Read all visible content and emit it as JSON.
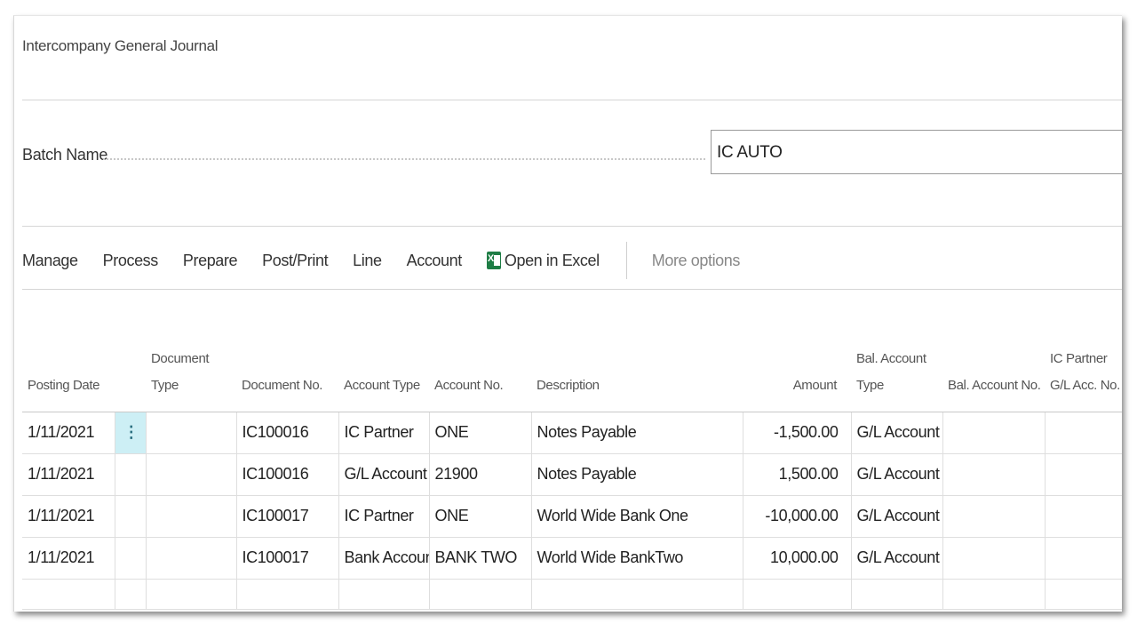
{
  "page": {
    "title": "Intercompany General Journal"
  },
  "batch": {
    "label": "Batch Name",
    "value": "IC AUTO"
  },
  "menu": {
    "items": [
      "Manage",
      "Process",
      "Prepare",
      "Post/Print",
      "Line",
      "Account"
    ],
    "open_in_excel": "Open in Excel",
    "more_options": "More options"
  },
  "grid": {
    "headers": {
      "posting_date": "Posting Date",
      "document_type": "Document Type",
      "document_no": "Document No.",
      "account_type": "Account Type",
      "account_no": "Account No.",
      "description": "Description",
      "amount": "Amount",
      "bal_account_type": "Bal. Account Type",
      "bal_account_no": "Bal. Account No.",
      "ic_partner_gl": "IC Partner G/L Acc. No."
    },
    "row_menu_icon": "⋮",
    "rows": [
      {
        "posting_date": "1/11/2021",
        "document_type": "",
        "document_no": "IC100016",
        "account_type": "IC Partner",
        "account_no": "ONE",
        "description": "Notes Payable",
        "amount": "-1,500.00",
        "bal_account_type": "G/L Account",
        "bal_account_no": "",
        "ic_partner_gl": ""
      },
      {
        "posting_date": "1/11/2021",
        "document_type": "",
        "document_no": "IC100016",
        "account_type": "G/L Account",
        "account_no": "21900",
        "description": "Notes Payable",
        "amount": "1,500.00",
        "bal_account_type": "G/L Account",
        "bal_account_no": "",
        "ic_partner_gl": ""
      },
      {
        "posting_date": "1/11/2021",
        "document_type": "",
        "document_no": "IC100017",
        "account_type": "IC Partner",
        "account_no": "ONE",
        "description": "World Wide Bank One",
        "amount": "-10,000.00",
        "bal_account_type": "G/L Account",
        "bal_account_no": "",
        "ic_partner_gl": ""
      },
      {
        "posting_date": "1/11/2021",
        "document_type": "",
        "document_no": "IC100017",
        "account_type": "Bank Account",
        "account_no": "BANK TWO",
        "description": "World Wide BankTwo",
        "amount": "10,000.00",
        "bal_account_type": "G/L Account",
        "bal_account_no": "",
        "ic_partner_gl": ""
      }
    ]
  },
  "colors": {
    "selected_cell_bg": "#cdeff5",
    "excel_green": "#1e7d45"
  }
}
